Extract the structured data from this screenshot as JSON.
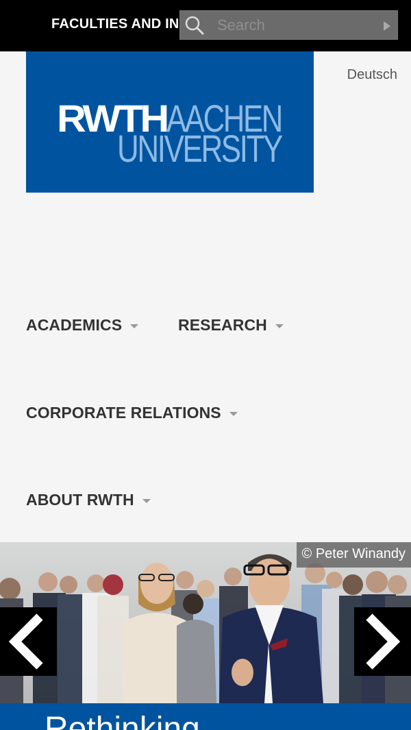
{
  "header": {
    "faculties_label": "FACULTIES AND INSTITUTES",
    "search_placeholder": "Search"
  },
  "logo": {
    "line1_bold": "RWTH",
    "line1_light": "AACHEN",
    "line2": "UNIVERSITY"
  },
  "language_link": "Deutsch",
  "nav": {
    "items": [
      {
        "label": "ACADEMICS"
      },
      {
        "label": "RESEARCH"
      },
      {
        "label": "CORPORATE RELATIONS"
      },
      {
        "label": "ABOUT RWTH"
      }
    ]
  },
  "slider": {
    "photo_credit": "© Peter Winandy",
    "caption": "Rethinking"
  },
  "colors": {
    "brand_blue": "#00549f",
    "header_black": "#000000"
  }
}
